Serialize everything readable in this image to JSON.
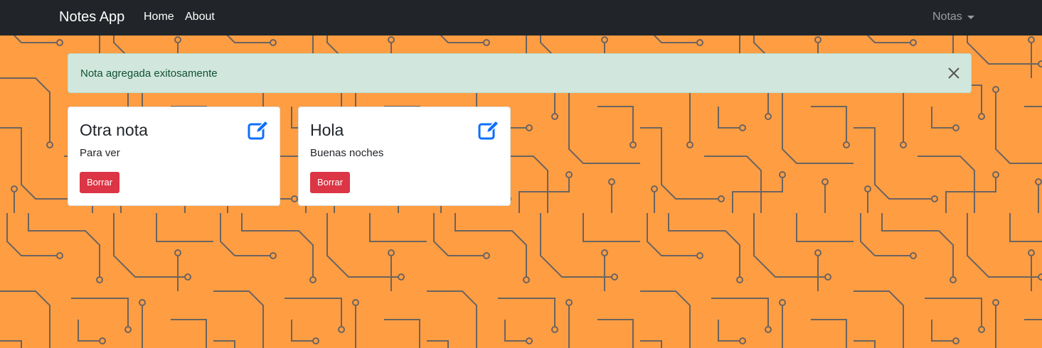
{
  "navbar": {
    "brand": "Notes App",
    "links": [
      "Home",
      "About"
    ],
    "dropdown_label": "Notas"
  },
  "alert": {
    "message": "Nota agregada exitosamente",
    "close_icon": "close-icon"
  },
  "notes": [
    {
      "title": "Otra nota",
      "body": "Para ver",
      "delete_label": "Borrar",
      "edit_icon": "edit-icon"
    },
    {
      "title": "Hola",
      "body": "Buenas noches",
      "delete_label": "Borrar",
      "edit_icon": "edit-icon"
    }
  ],
  "colors": {
    "background": "#ff9d42",
    "circuit_lines": "#6b6460",
    "navbar": "#212529",
    "alert_background": "#d1e7dd",
    "alert_text": "#0f5132",
    "edit_icon": "#0d6efd",
    "danger_button": "#dc3545"
  },
  "background_pattern": "circuit-board"
}
